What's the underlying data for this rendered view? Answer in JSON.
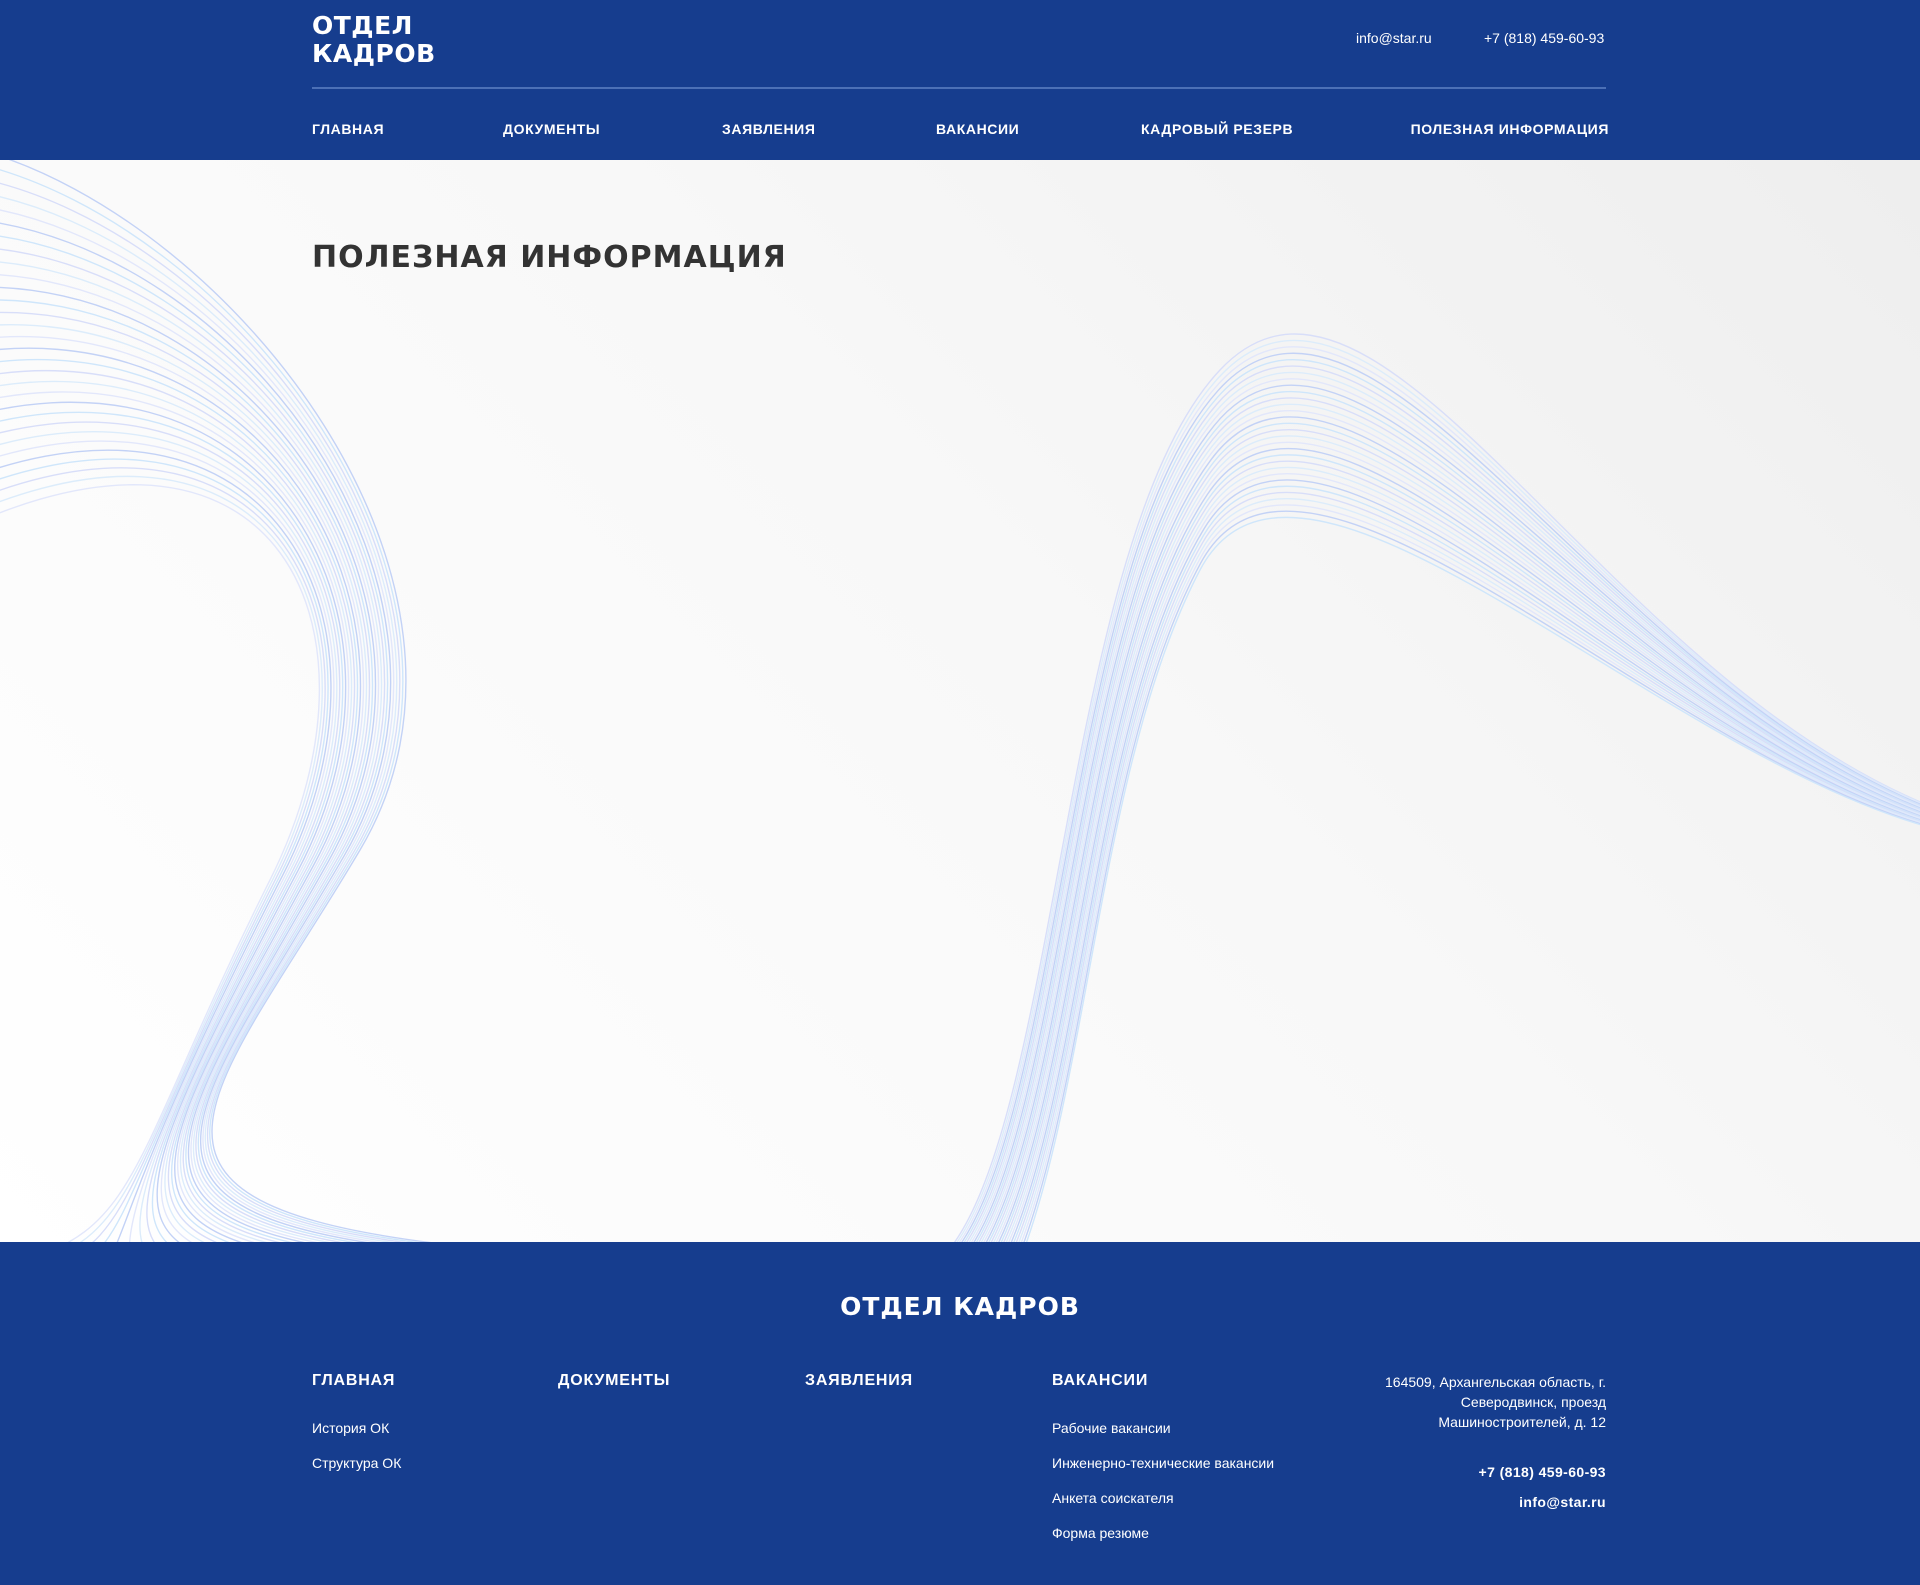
{
  "header": {
    "logo_line1": "ОТДЕЛ",
    "logo_line2": "КАДРОВ",
    "email": "info@star.ru",
    "phone": "+7 (818) 459-60-93"
  },
  "nav": {
    "items": [
      {
        "label": "ГЛАВНАЯ"
      },
      {
        "label": "ДОКУМЕНТЫ"
      },
      {
        "label": "ЗАЯВЛЕНИЯ"
      },
      {
        "label": "ВАКАНСИИ"
      },
      {
        "label": "КАДРОВЫЙ РЕЗЕРВ"
      },
      {
        "label": "ПОЛЕЗНАЯ ИНФОРМАЦИЯ"
      }
    ]
  },
  "main": {
    "title": "ПОЛЕЗНАЯ ИНФОРМАЦИЯ"
  },
  "footer": {
    "logo": "ОТДЕЛ КАДРОВ",
    "columns": [
      {
        "title": "ГЛАВНАЯ",
        "links": [
          "История ОК",
          "Структура ОК"
        ]
      },
      {
        "title": "ДОКУМЕНТЫ",
        "links": []
      },
      {
        "title": "ЗАЯВЛЕНИЯ",
        "links": []
      },
      {
        "title": "ВАКАНСИИ",
        "links": [
          "Рабочие вакансии",
          "Инженерно-технические вакансии",
          "Анкета соискателя",
          "Форма резюме"
        ]
      }
    ],
    "address": "164509, Архангельская область, г. Северодвинск, проезд Машиностроителей, д. 12",
    "phone": "+7 (818) 459-60-93",
    "email": "info@star.ru"
  },
  "colors": {
    "brand_blue": "#163d8e",
    "divider": "#4c70b6",
    "title_text": "#333333",
    "background": "#fafafa"
  }
}
